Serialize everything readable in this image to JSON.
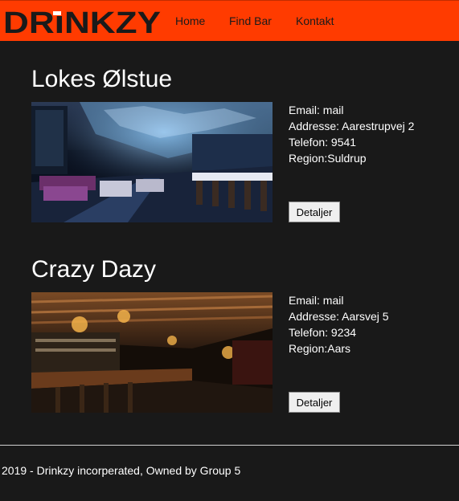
{
  "brand": {
    "logo_text": "DRINKZY",
    "accent": "#ff3b00"
  },
  "nav": {
    "home_label": "Home",
    "findbar_label": "Find Bar",
    "contact_label": "Kontakt"
  },
  "bars": [
    {
      "name": "Lokes Ølstue",
      "email": "Email: mail",
      "address": "Addresse: Aarestrupvej 2",
      "phone": "Telefon: 9541",
      "region": "Region:Suldrup",
      "details_label": "Detaljer"
    },
    {
      "name": "Crazy Dazy",
      "email": "Email: mail",
      "address": "Addresse: Aarsvej 5",
      "phone": "Telefon: 9234",
      "region": "Region:Aars",
      "details_label": "Detaljer"
    }
  ],
  "footer": {
    "text": "2019 - Drinkzy incorperated, Owned by Group 5"
  }
}
